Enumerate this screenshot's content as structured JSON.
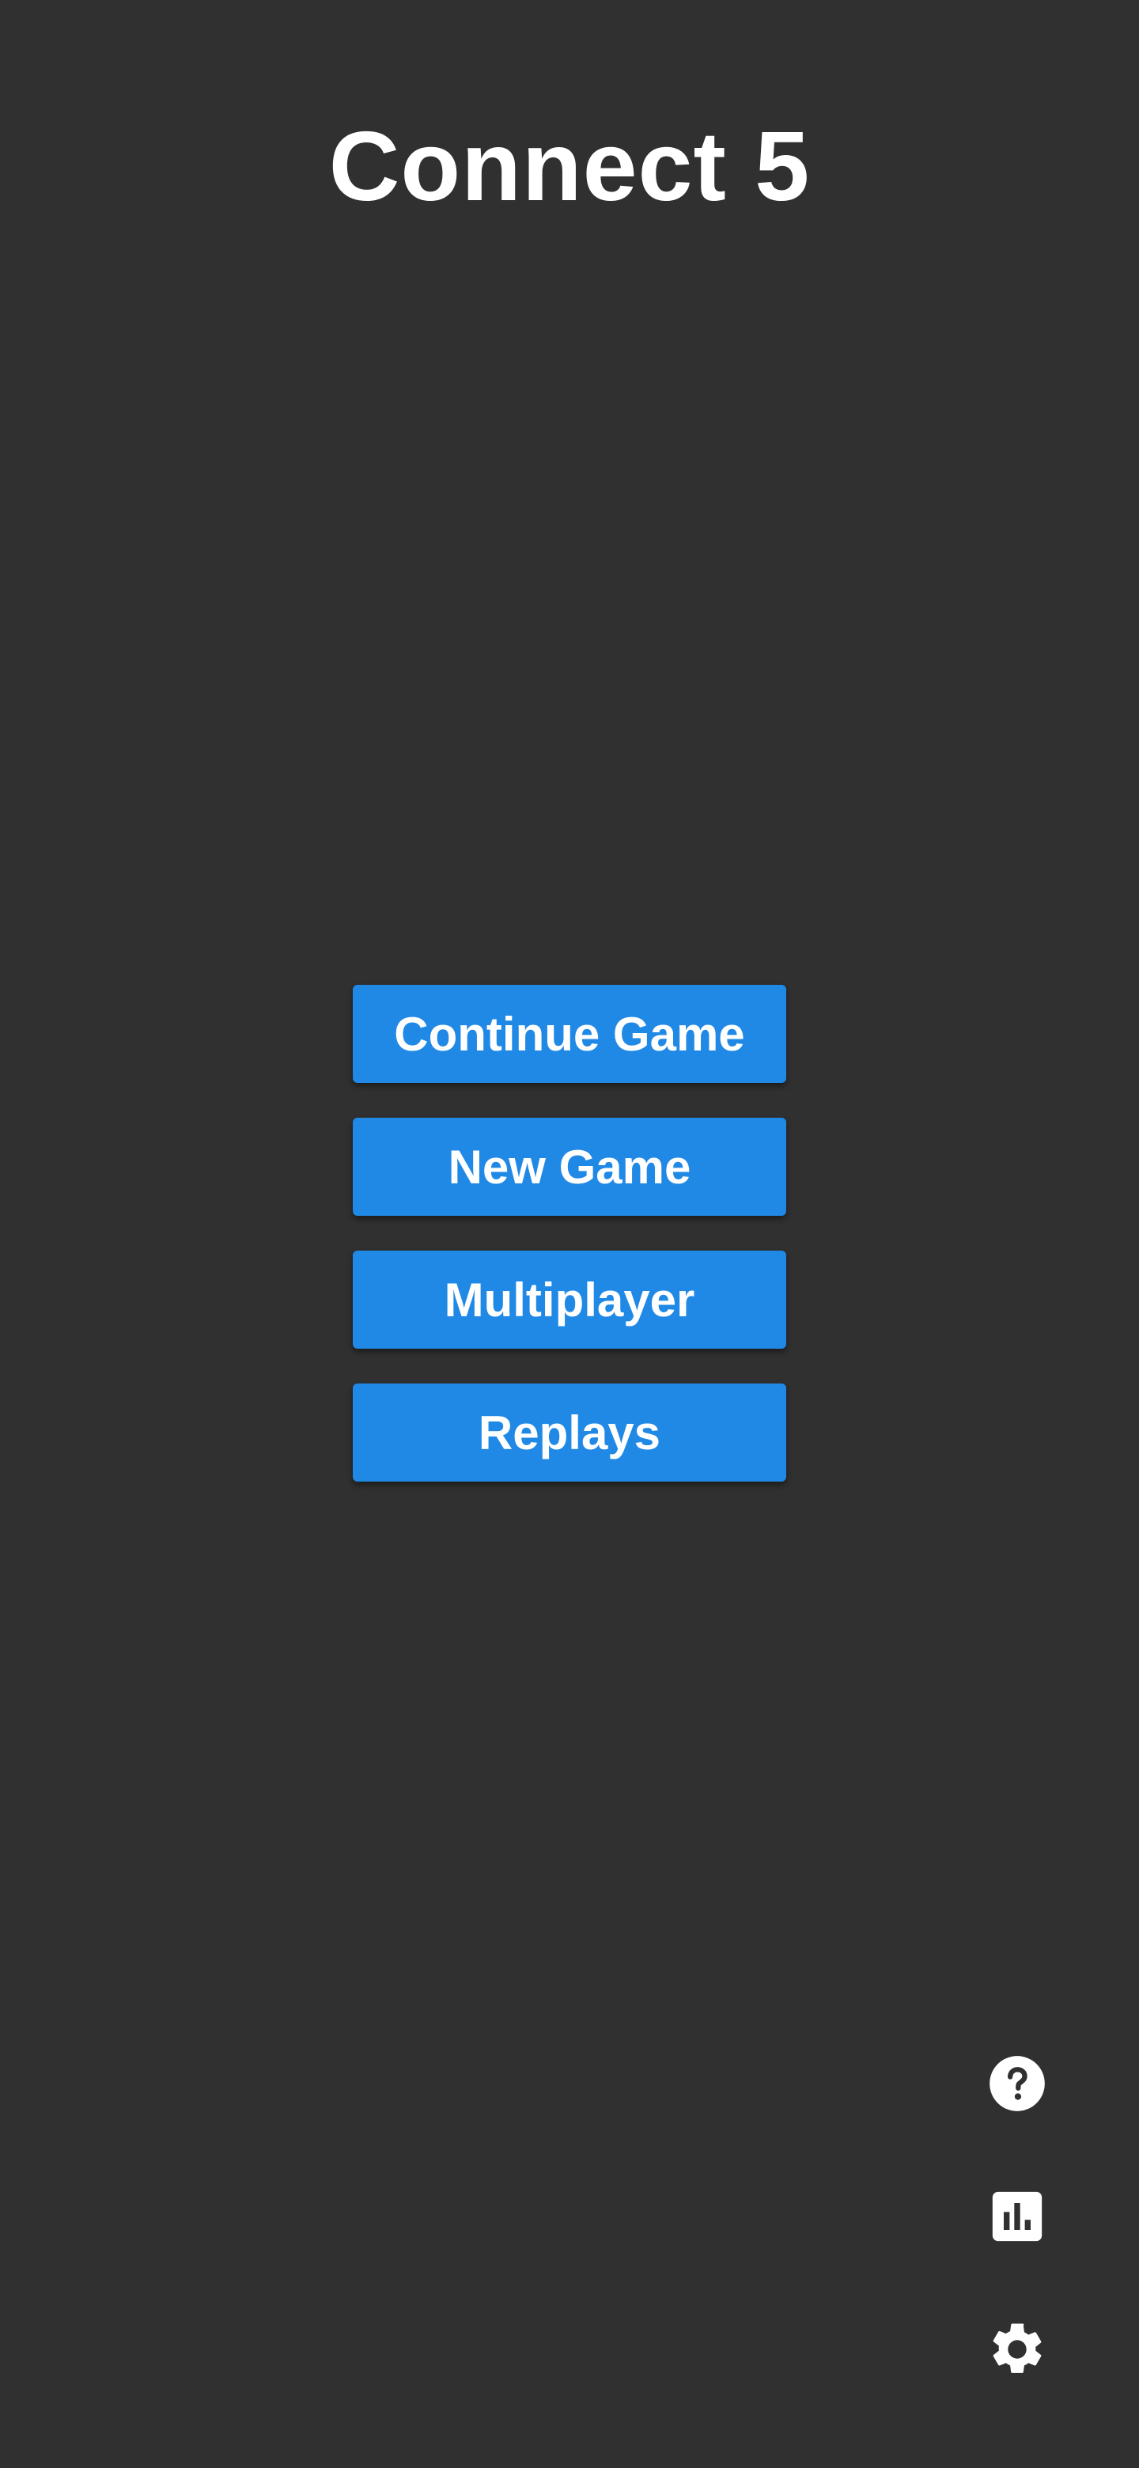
{
  "app": {
    "title": "Connect 5"
  },
  "menu": {
    "items": [
      {
        "label": "Continue Game"
      },
      {
        "label": "New Game"
      },
      {
        "label": "Multiplayer"
      },
      {
        "label": "Replays"
      }
    ]
  },
  "side_icons": {
    "help": "help-circle-icon",
    "stats": "bar-chart-icon",
    "settings": "gear-icon"
  },
  "colors": {
    "background": "#303030",
    "button": "#2089e6",
    "text": "#ffffff"
  }
}
